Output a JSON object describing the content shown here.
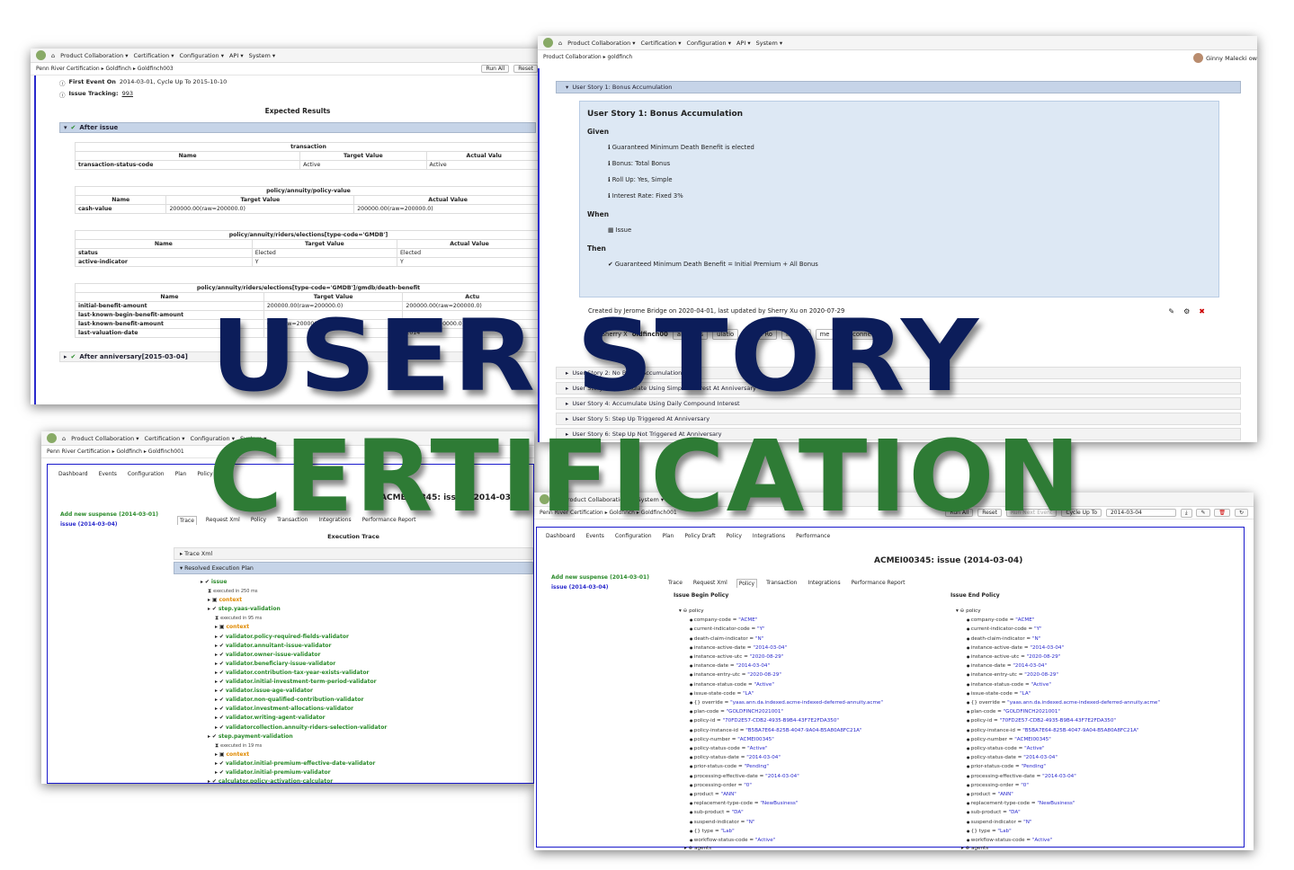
{
  "nav": {
    "items": [
      "Product Collaboration ▾",
      "Certification ▾",
      "Configuration ▾",
      "API ▾",
      "System ▾"
    ],
    "system_alt": "System ▾"
  },
  "shotA": {
    "breadcrumb": "Penn River Certification ▸ Goldfinch ▸ Goldfinch003",
    "run_all": "Run All",
    "reset": "Reset",
    "first_event_label": "First Event On",
    "first_event_value": "2014-03-01, Cycle Up To 2015-10-10",
    "issue_tracking_label": "Issue Tracking:",
    "issue_tracking_value": "993",
    "expected_results": "Expected Results",
    "after_issue": "After issue",
    "after_anniversary": "After anniversary[2015-03-04]",
    "col_name": "Name",
    "col_target": "Target Value",
    "col_actual": "Actual Value",
    "col_actual_short": "Actual Valu",
    "col_actual_trunc": "Actu",
    "t1": {
      "title": "transaction",
      "rows": [
        [
          "transaction-status-code",
          "Active",
          "Active"
        ]
      ]
    },
    "t2": {
      "title": "policy/annuity/policy-value",
      "rows": [
        [
          "cash-value",
          "200000.00(raw=200000.0)",
          "200000.00(raw=200000.0)"
        ]
      ]
    },
    "t3": {
      "title": "policy/annuity/riders/elections[type-code='GMDB']",
      "rows": [
        [
          "status",
          "Elected",
          "Elected"
        ],
        [
          "active-indicator",
          "Y",
          "Y"
        ]
      ]
    },
    "t4": {
      "title": "policy/annuity/riders/elections[type-code='GMDB']/gmdb/death-benefit",
      "rows": [
        [
          "initial-benefit-amount",
          "200000.00(raw=200000.0)",
          "200000.00(raw=200000.0)"
        ],
        [
          "last-known-begin-benefit-amount",
          "",
          ""
        ],
        [
          "last-known-benefit-amount",
          "0.00(raw=200000.0)",
          "0.00(raw=200000.0)"
        ],
        [
          "last-valuation-date",
          "",
          "2014"
        ]
      ]
    }
  },
  "shotB": {
    "breadcrumb": "Product Collaboration ▸ goldfinch",
    "user": "Ginny Malecki ow",
    "story1_header": "User Story 1: Bonus Accumulation",
    "story_title": "User Story 1: Bonus Accumulation",
    "given": "Given",
    "given_items": [
      "Guaranteed Minimum Death Benefit is elected",
      "Bonus: Total Bonus",
      "Roll Up: Yes, Simple",
      "Interest Rate: Fixed 3%"
    ],
    "when": "When",
    "when_item": "Issue",
    "then": "Then",
    "then_item": "Guaranteed Minimum Death Benefit = Initial Premium + All Bonus",
    "meta": "Created by  Jerome Bridge on 2020-04-01, last updated by  Sherry Xu on 2020-07-29",
    "row2_prefix": "Sherry X",
    "row2_link": "oldfinch00",
    "row2_b1": "al Bonus",
    "row2_b2": "ulatio",
    "row2_b3": "mple Ro",
    "row2_b4": "Indexe",
    "row2_b5": "me",
    "row2_disconnect": "Disconnect",
    "stories": [
      "User Story 2: No Bonus Accumulation",
      "User Story 3: Accumulate Using Simple Interest At Anniversary",
      "User Story 4: Accumulate Using Daily Compound Interest",
      "User Story 5: Step Up Triggered At Anniversary",
      "User Story 6: Step Up Not Triggered At Anniversary"
    ]
  },
  "shotC": {
    "breadcrumb": "Penn River Certification ▸ Goldfinch ▸ Goldfinch001",
    "topnav": [
      "Dashboard",
      "Events",
      "Configuration",
      "Plan",
      "Policy Draft",
      "Policy",
      "Integrations"
    ],
    "heading": "ACMEI00345: issue (2014-03",
    "add_suspense": "Add new suspense (2014-03-01)",
    "issue_link": "issue (2014-03-04)",
    "tabs": [
      "Trace",
      "Request Xml",
      "Policy",
      "Transaction",
      "Integrations",
      "Performance Report"
    ],
    "execution_trace": "Execution Trace",
    "trace_xml": "Trace Xml",
    "resolved_plan": "Resolved Execution Plan",
    "tree": [
      {
        "lvl": 0,
        "t": "issue",
        "c": "gr"
      },
      {
        "lvl": 1,
        "t": "executed in 250 ms",
        "c": "sm"
      },
      {
        "lvl": 1,
        "t": "context",
        "c": "or"
      },
      {
        "lvl": 1,
        "t": "step.yaas-validation",
        "c": "gr"
      },
      {
        "lvl": 2,
        "t": "executed in 95 ms",
        "c": "sm"
      },
      {
        "lvl": 2,
        "t": "context",
        "c": "or"
      },
      {
        "lvl": 2,
        "t": "validator.policy-required-fields-validator",
        "c": "gr"
      },
      {
        "lvl": 2,
        "t": "validator.annuitant-issue-validator",
        "c": "gr"
      },
      {
        "lvl": 2,
        "t": "validator.owner-issue-validator",
        "c": "gr"
      },
      {
        "lvl": 2,
        "t": "validator.beneficiary-issue-validator",
        "c": "gr"
      },
      {
        "lvl": 2,
        "t": "validator.contribution-tax-year-exists-validator",
        "c": "gr"
      },
      {
        "lvl": 2,
        "t": "validator.initial-investment-term-period-validator",
        "c": "gr"
      },
      {
        "lvl": 2,
        "t": "validator.issue-age-validator",
        "c": "gr"
      },
      {
        "lvl": 2,
        "t": "validator.non-qualified-contribution-validator",
        "c": "gr"
      },
      {
        "lvl": 2,
        "t": "validator.investment-allocations-validator",
        "c": "gr"
      },
      {
        "lvl": 2,
        "t": "validator.writing-agent-validator",
        "c": "gr"
      },
      {
        "lvl": 2,
        "t": "validatorcollection.annuity-riders-selection-validator",
        "c": "gr"
      },
      {
        "lvl": 1,
        "t": "step.payment-validation",
        "c": "gr"
      },
      {
        "lvl": 2,
        "t": "executed in 19 ms",
        "c": "sm"
      },
      {
        "lvl": 2,
        "t": "context",
        "c": "or"
      },
      {
        "lvl": 2,
        "t": "validator.initial-premium-effective-date-validator",
        "c": "gr"
      },
      {
        "lvl": 2,
        "t": "validator.initial-premium-validator",
        "c": "gr"
      },
      {
        "lvl": 1,
        "t": "calculator.policy-activation-calculator",
        "c": "gr"
      },
      {
        "lvl": 1,
        "t": "step.initialize-indexed-investment-step",
        "c": "gr"
      }
    ]
  },
  "shotD": {
    "breadcrumb": "Penn River Certification ▸ Goldfinch ▸ Goldfinch001",
    "run_all": "Run All",
    "reset": "Reset",
    "run_next": "Run Next Event",
    "cycle_up": "Cycle Up To",
    "cycle_value": "2014-03-04",
    "topnav": [
      "Dashboard",
      "Events",
      "Configuration",
      "Plan",
      "Policy Draft",
      "Policy",
      "Integrations",
      "Performance"
    ],
    "heading": "ACMEI00345: issue (2014-03-04)",
    "add_suspense": "Add new suspense (2014-03-01)",
    "issue_link": "issue (2014-03-04)",
    "tabs": [
      "Trace",
      "Request Xml",
      "Policy",
      "Transaction",
      "Integrations",
      "Performance Report"
    ],
    "begin_title": "Issue Begin Policy",
    "end_title": "Issue End Policy",
    "policy_root": "policy",
    "policy_lines": [
      [
        "company-code",
        "\"ACME\""
      ],
      [
        "current-indicator-code",
        "\"Y\""
      ],
      [
        "death-claim-indicator",
        "\"N\""
      ],
      [
        "instance-active-date",
        "\"2014-03-04\""
      ],
      [
        "instance-active-utc",
        "\"2020-08-29\""
      ],
      [
        "instance-date",
        "\"2014-03-04\""
      ],
      [
        "instance-entry-utc",
        "\"2020-08-29\""
      ],
      [
        "instance-status-code",
        "\"Active\""
      ],
      [
        "issue-state-code",
        "\"LA\""
      ],
      [
        "{} override",
        "\"yaas.ann.da.indexed.acme-indexed-deferred-annuity.acme\""
      ],
      [
        "plan-code",
        "\"GOLDFINCH2021001\""
      ],
      [
        "policy-id",
        "\"70FD2E57-CDB2-4935-B9B4-43F7E2FDA350\""
      ],
      [
        "policy-instance-id",
        "\"B5BA7E64-825B-4047-9A04-B5A80A8FC21A\""
      ],
      [
        "policy-number",
        "\"ACMEI00345\""
      ],
      [
        "policy-status-code",
        "\"Active\""
      ],
      [
        "policy-status-date",
        "\"2014-03-04\""
      ],
      [
        "prior-status-code",
        "\"Pending\""
      ],
      [
        "processing-effective-date",
        "\"2014-03-04\""
      ],
      [
        "processing-order",
        "\"0\""
      ],
      [
        "product",
        "\"ANN\""
      ],
      [
        "replacement-type-code",
        "\"NewBusiness\""
      ],
      [
        "sub-product",
        "\"DA\""
      ],
      [
        "suspend-indicator",
        "\"N\""
      ],
      [
        "{} type",
        "\"Lab\""
      ],
      [
        "workflow-status-code",
        "\"Active\""
      ]
    ],
    "policy_children": [
      "agents",
      "annuity",
      "date"
    ]
  },
  "overlay": {
    "line1": "USER STORY",
    "line2": "CERTIFICATION"
  },
  "colors": {
    "title_dark": "#0c1d5a",
    "title_green": "#2e7b35",
    "section_blue": "#c6d4e8",
    "green_text": "#2a8a2a"
  }
}
